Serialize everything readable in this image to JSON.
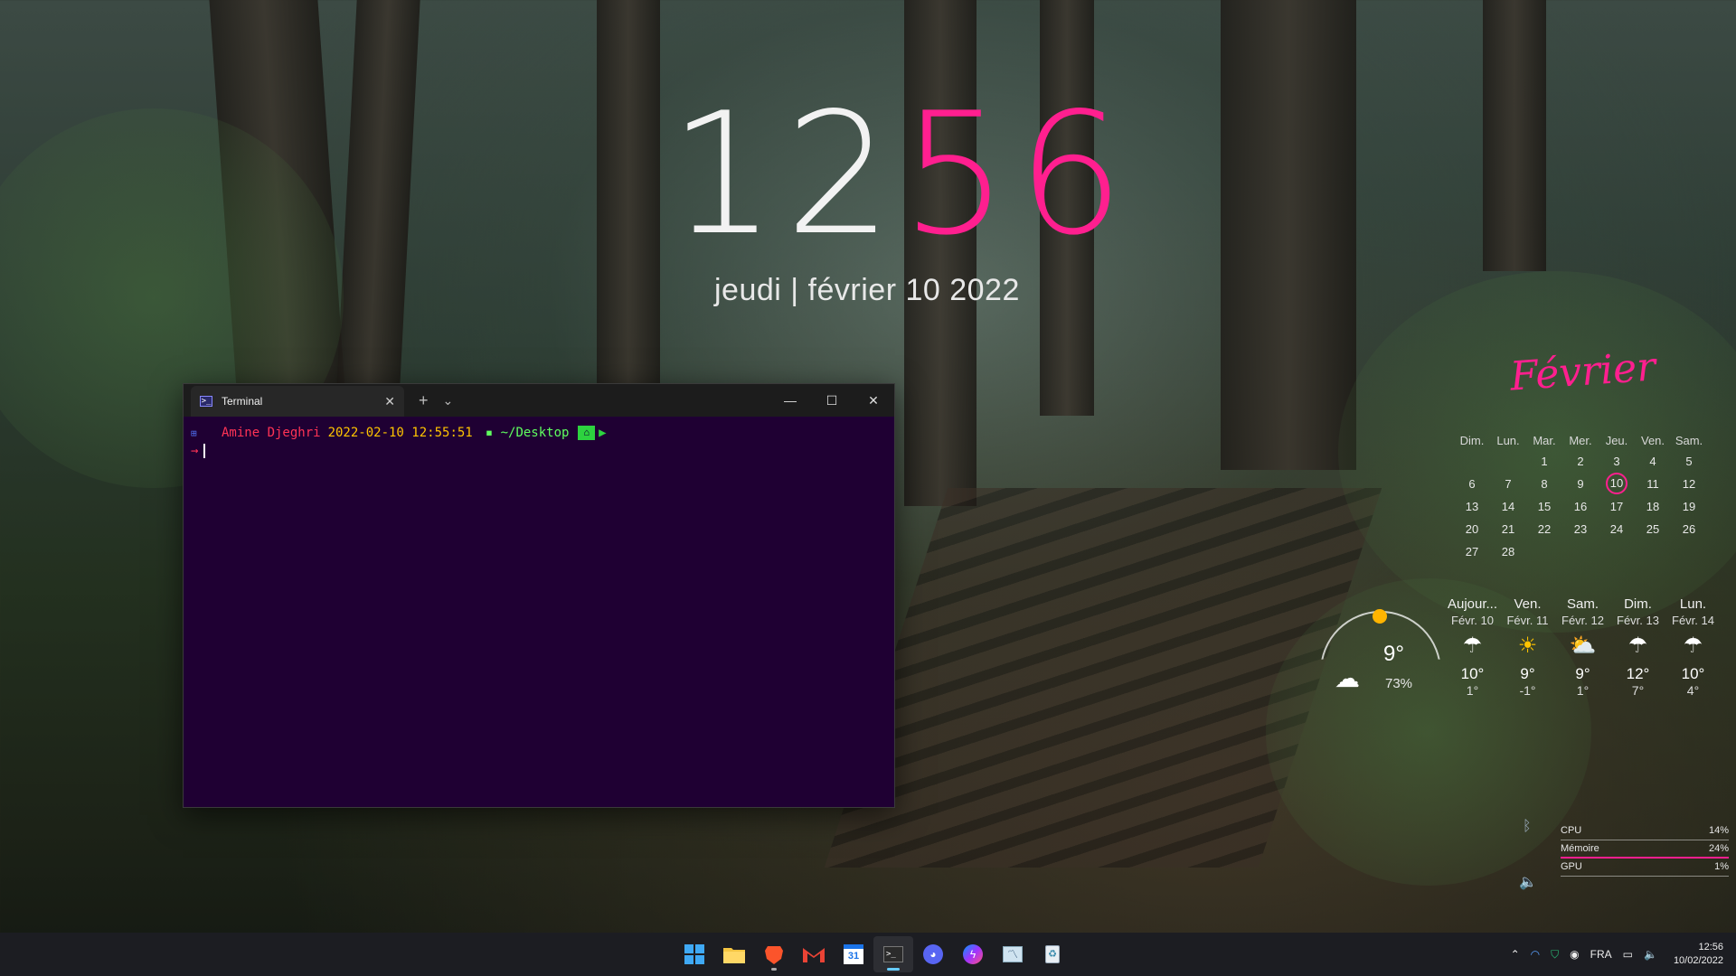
{
  "desktop": {
    "clock": {
      "hours": "12",
      "minutes": "56"
    },
    "date_line": "jeudi | février 10 2022",
    "accent": "#ff1f8f"
  },
  "terminal": {
    "tab_title": "Terminal",
    "tab_icon": "powershell-icon",
    "new_tab": "+",
    "dropdown": "⌄",
    "minimize": "—",
    "maximize": "☐",
    "close": "✕",
    "prompt": {
      "user": "Amine Djeghri",
      "datetime": "2022-02-10 12:55:51",
      "dir": "~/Desktop",
      "arrow": "→"
    },
    "background": "#1f0033"
  },
  "calendar": {
    "month": "Février",
    "weekdays": [
      "Dim.",
      "Lun.",
      "Mar.",
      "Mer.",
      "Jeu.",
      "Ven.",
      "Sam."
    ],
    "weeks": [
      [
        "",
        "",
        "1",
        "2",
        "3",
        "4",
        "5"
      ],
      [
        "6",
        "7",
        "8",
        "9",
        "10",
        "11",
        "12"
      ],
      [
        "13",
        "14",
        "15",
        "16",
        "17",
        "18",
        "19"
      ],
      [
        "20",
        "21",
        "22",
        "23",
        "24",
        "25",
        "26"
      ],
      [
        "27",
        "28",
        "",
        "",
        "",
        "",
        ""
      ]
    ],
    "today": "10"
  },
  "weather": {
    "now": {
      "temp": "9°",
      "humidity": "73%",
      "icon": "cloud-icon"
    },
    "forecast": [
      {
        "day": "Aujour...",
        "date": "Févr. 10",
        "icon": "rain-cloud-icon",
        "hi": "10°",
        "lo": "1°"
      },
      {
        "day": "Ven.",
        "date": "Févr. 11",
        "icon": "sun-icon",
        "hi": "9°",
        "lo": "-1°"
      },
      {
        "day": "Sam.",
        "date": "Févr. 12",
        "icon": "partly-cloudy-icon",
        "hi": "9°",
        "lo": "1°"
      },
      {
        "day": "Dim.",
        "date": "Févr. 13",
        "icon": "rain-cloud-icon",
        "hi": "12°",
        "lo": "7°"
      },
      {
        "day": "Lun.",
        "date": "Févr. 14",
        "icon": "rain-cloud-icon",
        "hi": "10°",
        "lo": "4°"
      }
    ]
  },
  "sysmon": {
    "rows": [
      {
        "label": "CPU",
        "value": "14%"
      },
      {
        "label": "Mémoire",
        "value": "24%"
      },
      {
        "label": "GPU",
        "value": "1%"
      }
    ]
  },
  "taskbar": {
    "apps": [
      "start-icon",
      "file-explorer-icon",
      "brave-icon",
      "gmail-icon",
      "calendar-icon",
      "terminal-icon",
      "discord-icon",
      "messenger-icon",
      "monitor-icon",
      "recycle-bin-icon"
    ],
    "calendar_app_num": "31",
    "tray": {
      "language": "FRA",
      "time": "12:56",
      "date": "10/02/2022"
    }
  }
}
